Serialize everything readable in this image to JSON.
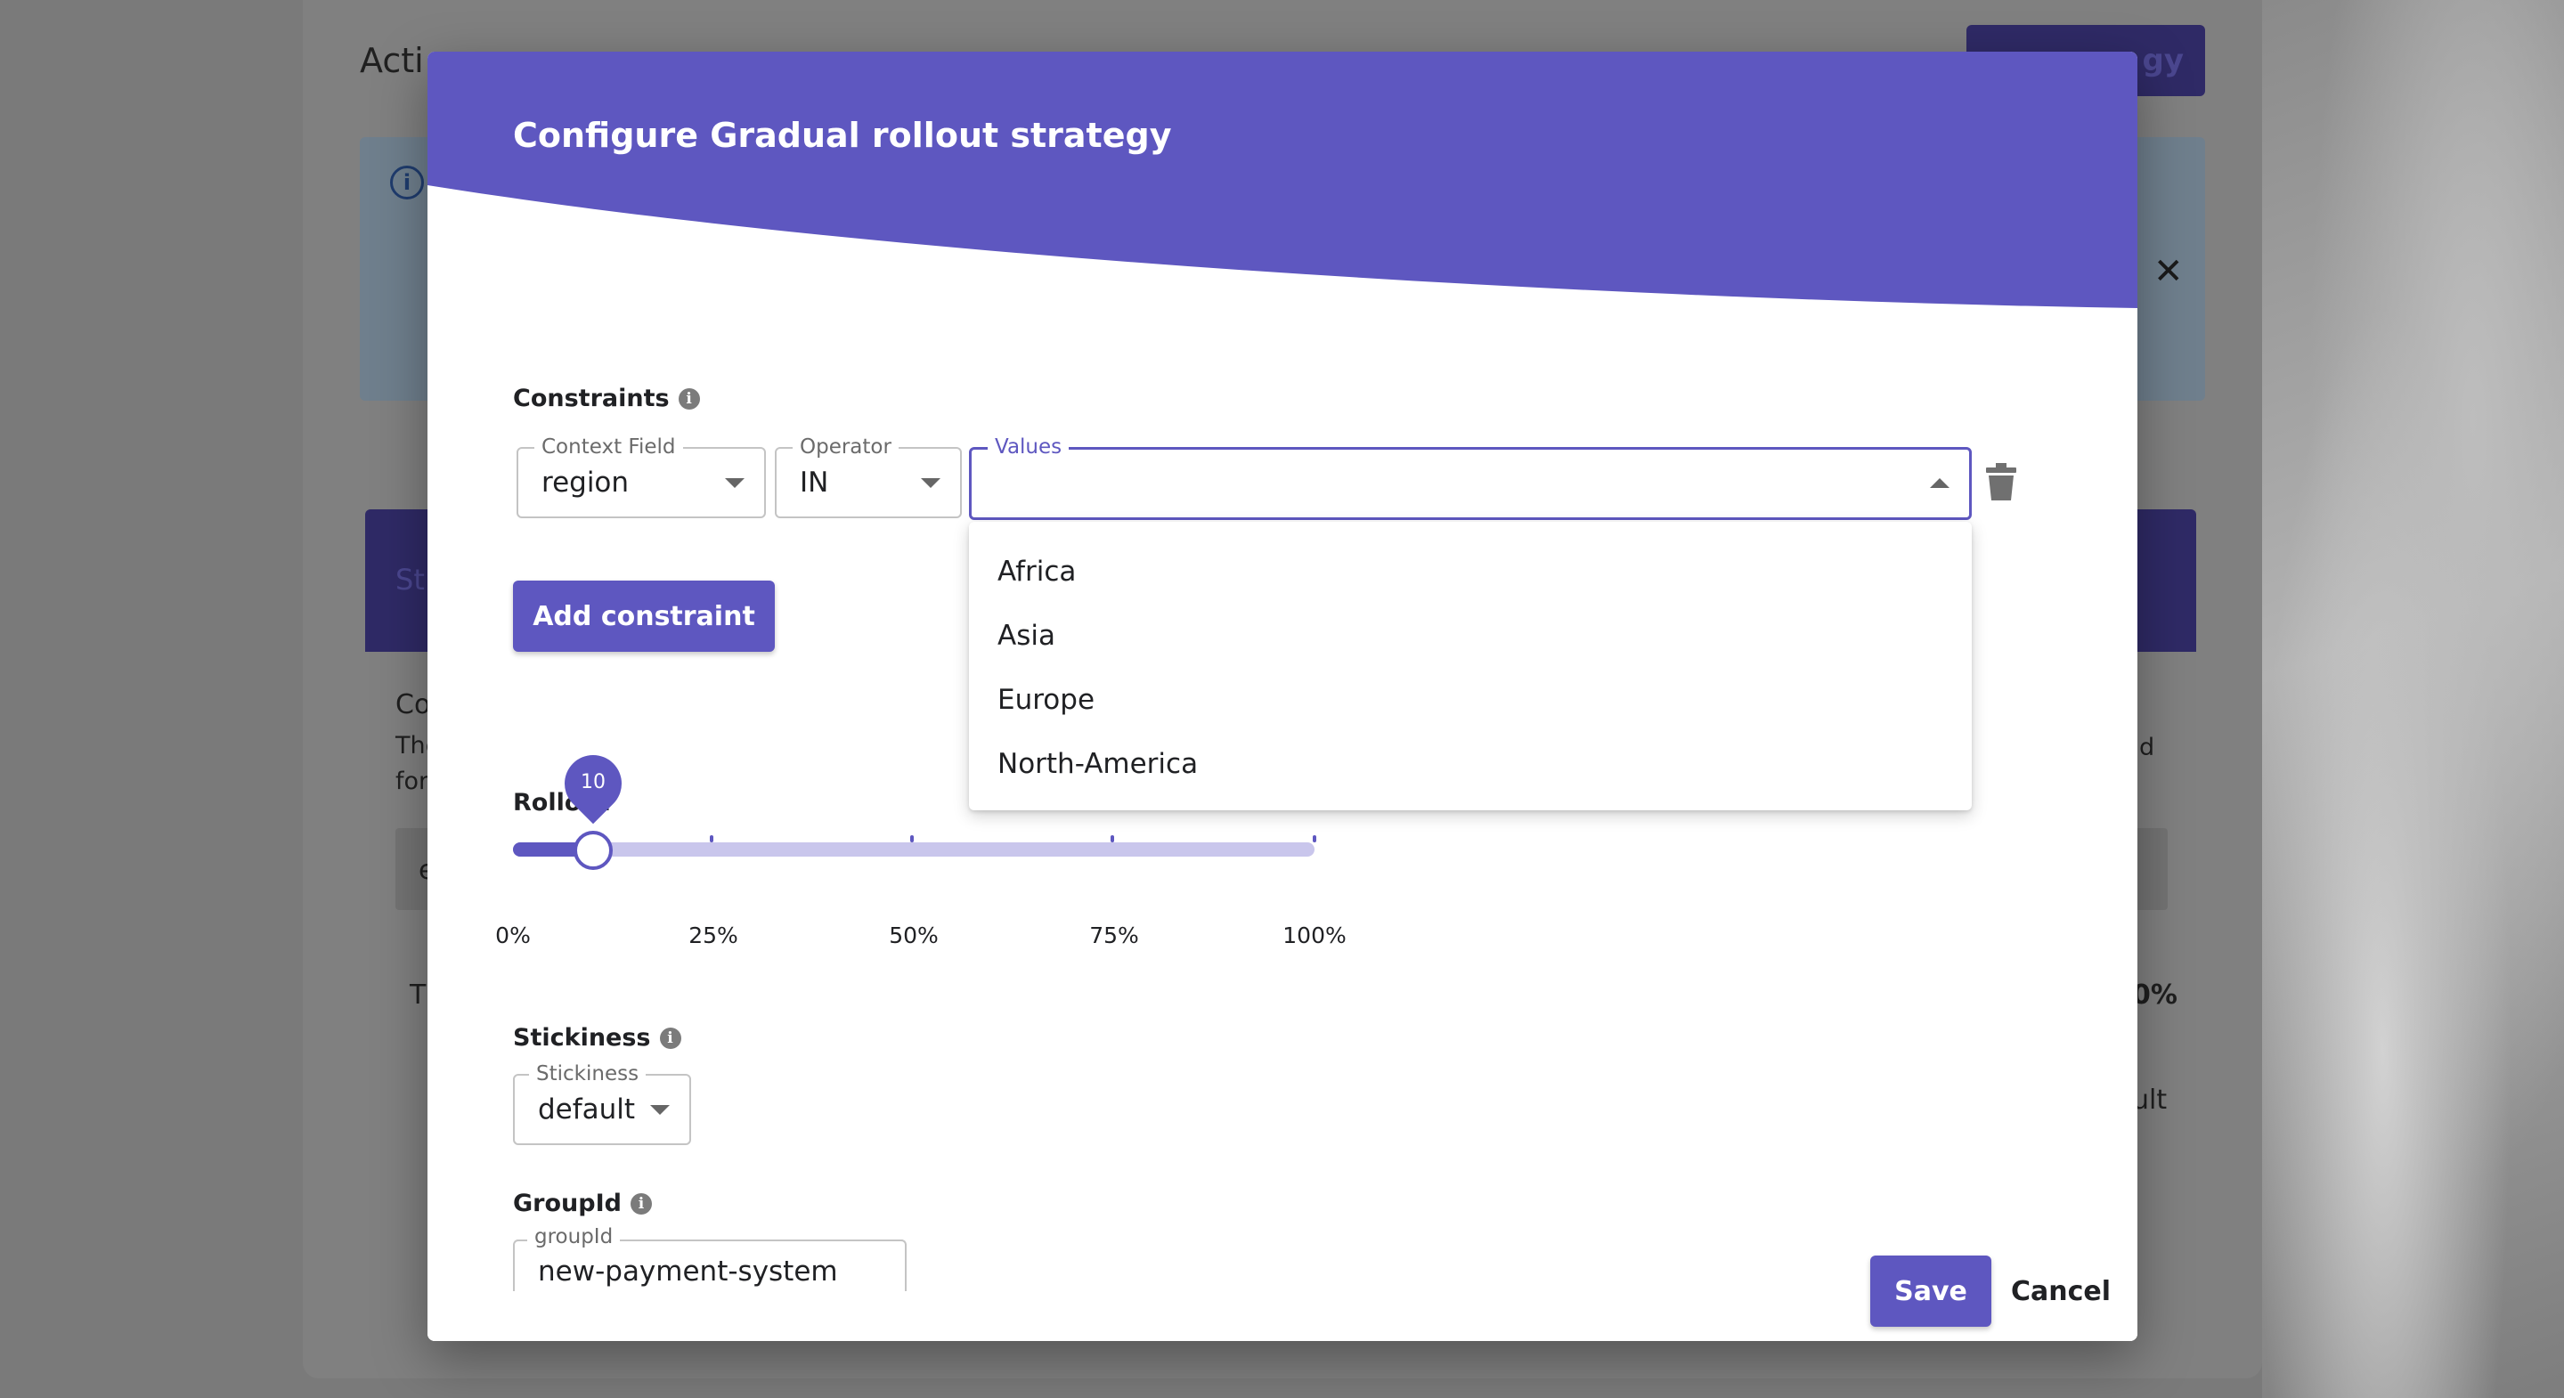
{
  "background": {
    "heading": "Acti",
    "add_button": "gy",
    "card_header": "St",
    "card_line1": "Co",
    "card_line2": "The",
    "card_line3": "for",
    "card_row": "e",
    "card_t": "T",
    "card_right1": "d",
    "card_right2": "0%",
    "card_right3": "ult"
  },
  "modal": {
    "title": "Configure Gradual rollout strategy",
    "header_color": "#5e57c0"
  },
  "constraints": {
    "label": "Constraints",
    "context_field": {
      "legend": "Context Field",
      "value": "region"
    },
    "operator": {
      "legend": "Operator",
      "value": "IN"
    },
    "values": {
      "legend": "Values",
      "value": "",
      "open": true
    },
    "options": [
      "Africa",
      "Asia",
      "Europe",
      "North-America"
    ],
    "add_button": "Add constraint"
  },
  "rollout": {
    "label": "Rollout",
    "value": 10,
    "value_text": "10",
    "min": 0,
    "max": 100,
    "marks": [
      "0%",
      "25%",
      "50%",
      "75%",
      "100%"
    ]
  },
  "stickiness": {
    "label": "Stickiness",
    "legend": "Stickiness",
    "value": "default"
  },
  "group_id": {
    "label": "GroupId",
    "legend": "groupId",
    "value": "new-payment-system"
  },
  "actions": {
    "save": "Save",
    "cancel": "Cancel"
  },
  "icons": {
    "info": "info-icon",
    "delete": "trash-icon",
    "close": "close-icon"
  },
  "colors": {
    "primary": "#5e57c0",
    "primary_light": "#c9c6ec"
  }
}
